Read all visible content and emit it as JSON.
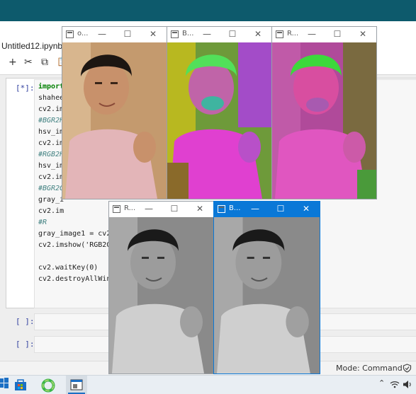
{
  "notebook": {
    "title": "Untitled12.ipynb",
    "toolbar": [
      "+",
      "✂",
      "⧉",
      "📋"
    ],
    "cell_prompts": [
      "[*]:",
      "[ ]:",
      "[ ]:"
    ],
    "code_lines": [
      "import",
      "shahee",
      "cv2.im",
      "#BGR2H",
      "hsv_im",
      "cv2.im",
      "#RGB2H",
      "hsv_im",
      "cv2.im",
      "#BGR2G",
      "gray_i",
      "cv2.im",
      "#R",
      "gray_image1 = cv2.",
      "cv2.imshow('RGB2GR",
      "",
      "cv2.waitKey(0)",
      "cv2.destroyAllWind"
    ]
  },
  "statusbar": {
    "mode": "Mode: Command"
  },
  "windows": [
    {
      "id": "original",
      "title": "o...",
      "style": "photo-color"
    },
    {
      "id": "bgr2hsv",
      "title": "B...",
      "style": "photo-hsv1"
    },
    {
      "id": "rgb2hsv",
      "title": "R...",
      "style": "photo-hsv2"
    },
    {
      "id": "rgb2gray",
      "title": "R...",
      "style": "photo-gray"
    },
    {
      "id": "bgr2gray",
      "title": "B...",
      "style": "photo-gray",
      "active": true
    }
  ],
  "window_controls": {
    "minimize": "—",
    "maximize": "☐",
    "close": "✕"
  },
  "colors": {
    "jupyter_topbar": "#0d5a6c",
    "active_titlebar": "#0a78d7",
    "prompt": "#303f9f"
  },
  "taskbar": {
    "icons": [
      "windows-start-icon",
      "store-icon",
      "chrome-icon",
      "app-icon"
    ],
    "tray": [
      "chevron-up-icon",
      "network-icon",
      "volume-icon"
    ]
  }
}
